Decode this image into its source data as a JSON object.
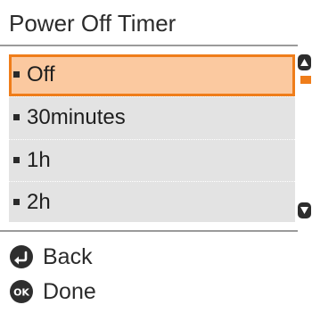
{
  "header": {
    "title": "Power Off Timer"
  },
  "list": {
    "items": [
      {
        "label": "Off",
        "selected": true
      },
      {
        "label": "30minutes",
        "selected": false
      },
      {
        "label": "1h",
        "selected": false
      },
      {
        "label": "2h",
        "selected": false
      }
    ]
  },
  "scrollbar": {
    "up_icon": "scroll-up-arrow-icon",
    "down_icon": "scroll-down-arrow-icon",
    "thumb_color": "#ef7d1a"
  },
  "footer": {
    "back": {
      "label": "Back",
      "icon": "back-icon"
    },
    "done": {
      "label": "Done",
      "icon": "ok-icon",
      "icon_text": "OK"
    }
  },
  "colors": {
    "accent": "#ef7d1a",
    "selection_fill": "#fbc9a0",
    "list_background": "#e3e3e3"
  }
}
